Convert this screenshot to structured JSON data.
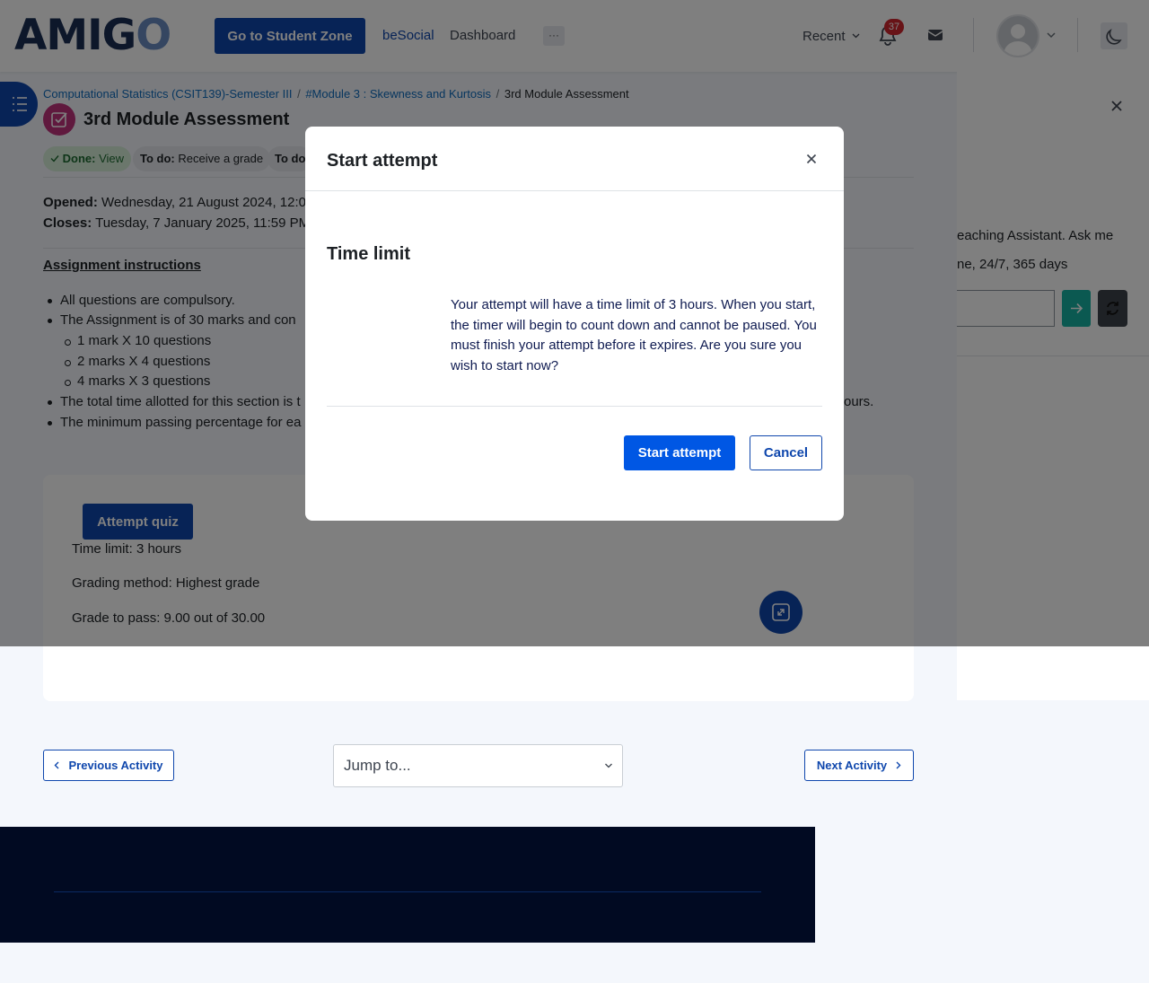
{
  "header": {
    "logo": {
      "prefix": "AMIG",
      "suffix": "O"
    },
    "student_zone_label": "Go to Student Zone",
    "nav_besocial": "beSocial",
    "nav_dashboard": "Dashboard",
    "nav_more": "···",
    "recent_label": "Recent",
    "notification_count": "37",
    "icons": [
      "bell-icon",
      "mail-icon",
      "avatar",
      "chevron-down-icon",
      "moon-icon"
    ]
  },
  "breadcrumb": {
    "course": "Computational Statistics (CSIT139)-Semester III",
    "module": "#Module 3 : Skewness and Kurtosis",
    "current": "3rd Module Assessment",
    "sep": "/"
  },
  "page": {
    "title": "3rd Module Assessment",
    "completion": [
      {
        "label": "Done:",
        "value": "View"
      },
      {
        "label": "To do:",
        "value": "Receive a grade"
      },
      {
        "label": "To do:",
        "value": ""
      }
    ],
    "opened_label": "Opened:",
    "opened_value": "Wednesday, 21 August 2024, 12:0",
    "closes_label": "Closes:",
    "closes_value": "Tuesday, 7 January 2025, 11:59 PM",
    "instructions_title": "Assignment instructions",
    "instructions": {
      "item1": "All questions are compulsory.",
      "item2": "The Assignment is of 30 marks and con",
      "sub1": "1 mark X 10 questions",
      "sub2": "2 marks X 4 questions",
      "sub3": "4 marks X 3 questions",
      "item3_start": "The total time allotted for this section is t",
      "item3_end": "ours.",
      "item4": "The minimum passing percentage for ea"
    }
  },
  "quiz": {
    "attempt_label": "Attempt quiz",
    "time_limit": "Time limit: 3 hours",
    "grading_method": "Grading method: Highest grade",
    "grade_to_pass": "Grade to pass: 9.00 out of 30.00"
  },
  "assistant": {
    "line1": "eaching Assistant. Ask me",
    "line2": "ne, 24/7, 365 days"
  },
  "activity_nav": {
    "previous": "Previous Activity",
    "next": "Next Activity",
    "jump_placeholder": "Jump to..."
  },
  "modal": {
    "title": "Start attempt",
    "subtitle": "Time limit",
    "message": "Your attempt will have a time limit of 3 hours. When you start, the timer will begin to count down and cannot be paused. You must finish your attempt before it expires. Are you sure you wish to start now?",
    "start_label": "Start attempt",
    "cancel_label": "Cancel"
  },
  "colors": {
    "brand_blue": "#0f47ad",
    "primary_button": "#0057e4",
    "teal": "#17b3a3",
    "footer": "#010a22",
    "badge_red": "#d0262f"
  }
}
